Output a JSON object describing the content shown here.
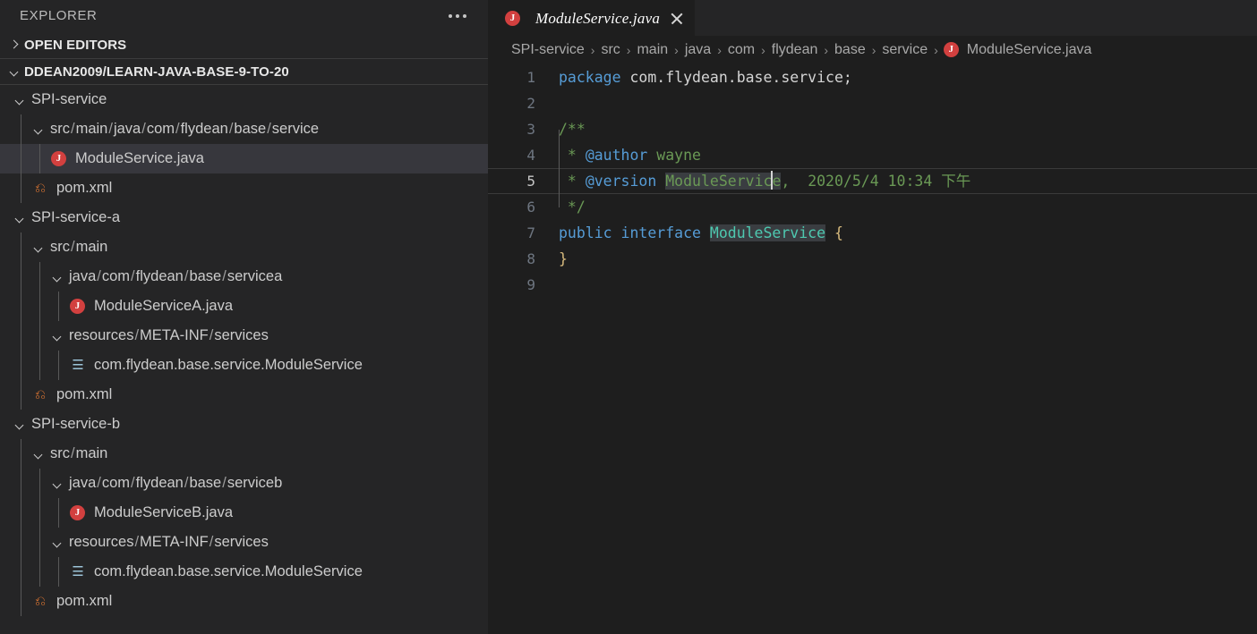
{
  "sidebar": {
    "title": "EXPLORER",
    "more_actions_icon": "ellipsis-icon",
    "sections": [
      {
        "label": "OPEN EDITORS",
        "expanded": false
      },
      {
        "label": "DDEAN2009/LEARN-JAVA-BASE-9-TO-20",
        "expanded": true
      }
    ],
    "tree": [
      {
        "label": "SPI-service",
        "kind": "folder",
        "depth": 0,
        "expanded": true,
        "selected": false
      },
      {
        "label": "src / main / java / com / flydean / base / service",
        "kind": "folder",
        "depth": 1,
        "expanded": true,
        "selected": false
      },
      {
        "label": "ModuleService.java",
        "kind": "java",
        "depth": 2,
        "expanded": null,
        "selected": true
      },
      {
        "label": "pom.xml",
        "kind": "xml",
        "depth": 1,
        "expanded": null,
        "selected": false
      },
      {
        "label": "SPI-service-a",
        "kind": "folder",
        "depth": 0,
        "expanded": true,
        "selected": false
      },
      {
        "label": "src / main",
        "kind": "folder",
        "depth": 1,
        "expanded": true,
        "selected": false
      },
      {
        "label": "java / com / flydean / base / servicea",
        "kind": "folder",
        "depth": 2,
        "expanded": true,
        "selected": false
      },
      {
        "label": "ModuleServiceA.java",
        "kind": "java",
        "depth": 3,
        "expanded": null,
        "selected": false
      },
      {
        "label": "resources / META-INF / services",
        "kind": "folder",
        "depth": 2,
        "expanded": true,
        "selected": false
      },
      {
        "label": "com.flydean.base.service.ModuleService",
        "kind": "file",
        "depth": 3,
        "expanded": null,
        "selected": false
      },
      {
        "label": "pom.xml",
        "kind": "xml",
        "depth": 1,
        "expanded": null,
        "selected": false
      },
      {
        "label": "SPI-service-b",
        "kind": "folder",
        "depth": 0,
        "expanded": true,
        "selected": false
      },
      {
        "label": "src / main",
        "kind": "folder",
        "depth": 1,
        "expanded": true,
        "selected": false
      },
      {
        "label": "java / com / flydean / base / serviceb",
        "kind": "folder",
        "depth": 2,
        "expanded": true,
        "selected": false
      },
      {
        "label": "ModuleServiceB.java",
        "kind": "java",
        "depth": 3,
        "expanded": null,
        "selected": false
      },
      {
        "label": "resources / META-INF / services",
        "kind": "folder",
        "depth": 2,
        "expanded": true,
        "selected": false
      },
      {
        "label": "com.flydean.base.service.ModuleService",
        "kind": "file",
        "depth": 3,
        "expanded": null,
        "selected": false
      },
      {
        "label": "pom.xml",
        "kind": "xml",
        "depth": 1,
        "expanded": null,
        "selected": false
      }
    ]
  },
  "editor": {
    "tab": {
      "title": "ModuleService.java",
      "icon": "java-icon",
      "close_icon": "close-icon",
      "preview": true,
      "active": true
    },
    "breadcrumb": [
      "SPI-service",
      "src",
      "main",
      "java",
      "com",
      "flydean",
      "base",
      "service"
    ],
    "breadcrumb_file": "ModuleService.java",
    "active_line": 5,
    "cursor_line": 5,
    "lines": [
      {
        "n": "1",
        "text": "package com.flydean.base.service;"
      },
      {
        "n": "2",
        "text": ""
      },
      {
        "n": "3",
        "text": "/**"
      },
      {
        "n": "4",
        "text": " * @author wayne"
      },
      {
        "n": "5",
        "text": " * @version ModuleService,  2020/5/4 10:34 下午"
      },
      {
        "n": "6",
        "text": " */"
      },
      {
        "n": "7",
        "text": "public interface ModuleService {"
      },
      {
        "n": "8",
        "text": "}"
      },
      {
        "n": "9",
        "text": ""
      }
    ],
    "tokens": {
      "kw_package": "package",
      "package_name": "com.flydean.base.service;",
      "doc_open": "/**",
      "doc_star": " * ",
      "tag_author": "@author",
      "author_value": " wayne",
      "tag_version": "@version",
      "version_symbol": "ModuleService",
      "version_rest": ",  2020/5/4 10:34 下午",
      "doc_close": " */",
      "kw_public": "public",
      "kw_interface": "interface",
      "type_name": "ModuleService",
      "brace_open": "{",
      "brace_close": "}"
    }
  },
  "colors": {
    "sidebar_bg": "#252526",
    "editor_bg": "#1e1e1e",
    "selection_bg": "#37373d",
    "keyword": "#569cd6",
    "type": "#4ec9b0",
    "comment": "#6a9955",
    "plain": "#d4d4d4",
    "brace": "#d7ba7d",
    "java_icon": "#d2403f",
    "xml_icon": "#e37933"
  }
}
